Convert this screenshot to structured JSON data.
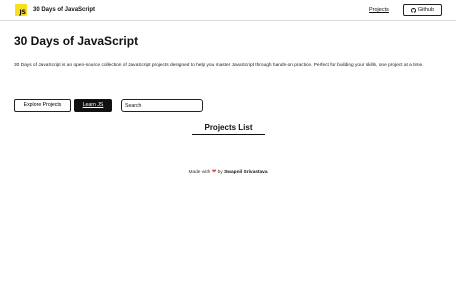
{
  "navbar": {
    "logo_text": "JS",
    "brand": "30 Days of JavaScript",
    "projects_link": "Projects",
    "github_label": "Github"
  },
  "hero": {
    "title": "30 Days of JavaScript",
    "description": "30 Days of JavaScript is an open-source collection of JavaScript projects designed to help you master JavaScript through hands-on practice. Perfect for building your skills, one project at a time."
  },
  "actions": {
    "explore_label": "Explore Projects",
    "learn_label": "Learn JS",
    "search_placeholder": "Search"
  },
  "section": {
    "projects_heading": "Projects List"
  },
  "footer": {
    "made_with": "Made with",
    "by": "by",
    "author": "Swapnil Srivastava"
  },
  "colors": {
    "accent": "#f7df1e",
    "heart": "#e5484d",
    "dark_button": "#111111"
  },
  "icons": {
    "logo": "js-logo-icon",
    "github": "github-icon",
    "heart": "heart-icon"
  }
}
